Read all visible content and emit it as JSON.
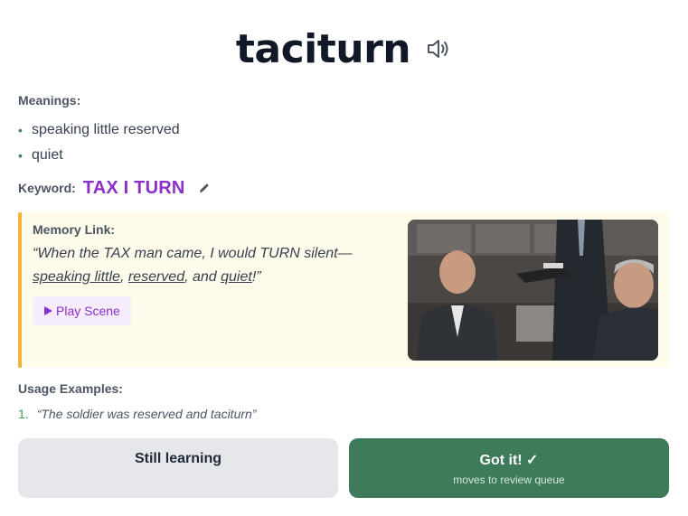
{
  "word": "taciturn",
  "icons": {
    "speaker": "speaker-icon",
    "edit": "pencil-icon",
    "play": "play-icon"
  },
  "meanings": {
    "label": "Meanings:",
    "bullet": "•",
    "items": [
      "speaking little reserved",
      "quiet"
    ]
  },
  "keyword": {
    "label": "Keyword:",
    "value": "TAX I TURN"
  },
  "memory": {
    "label": "Memory Link:",
    "quote_start": "“When the TAX man came, I would TURN silent—",
    "u1": "speaking little",
    "sep1": ", ",
    "u2": "reserved",
    "sep2": ", and ",
    "u3": "quiet",
    "quote_end": "!”",
    "play_label": "Play Scene"
  },
  "usage": {
    "label": "Usage Examples:",
    "examples": [
      {
        "num": "1.",
        "text": "“The soldier was reserved and taciturn”"
      }
    ]
  },
  "actions": {
    "still_learning": "Still learning",
    "got_it": "Got it! ✓",
    "got_it_sub": "moves to review queue"
  },
  "colors": {
    "keyword": "#8b2fc9",
    "accent_border": "#f1b43a",
    "memory_bg": "#fffbea",
    "got_it_bg": "#3e7b5b",
    "still_learning_bg": "#e5e7eb"
  }
}
